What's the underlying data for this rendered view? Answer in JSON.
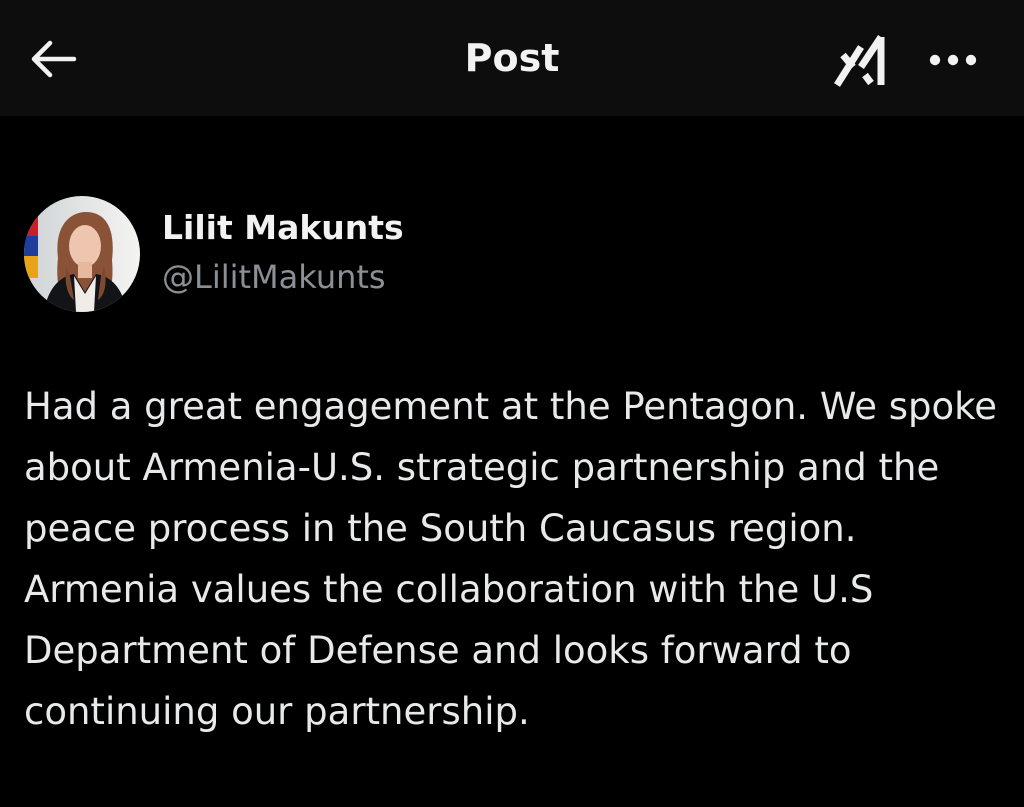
{
  "header": {
    "title": "Post",
    "back_icon": "arrow-left-icon",
    "grok_icon": "grok-logo-icon",
    "more_icon": "ellipsis-icon"
  },
  "author": {
    "name": "Lilit Makunts",
    "handle": "@LilitMakunts"
  },
  "post": {
    "text": "Had a great engagement at the Pentagon. We spoke about Armenia-U.S. strategic partnership and the peace process in the South Caucasus region. Armenia values the collaboration with the U.S Department of Defense and looks forward to continuing our partnership."
  },
  "colors": {
    "background": "#000000",
    "header_background": "#0d0d0d",
    "text_primary": "#e7e9ea",
    "text_secondary": "#8b9096"
  }
}
